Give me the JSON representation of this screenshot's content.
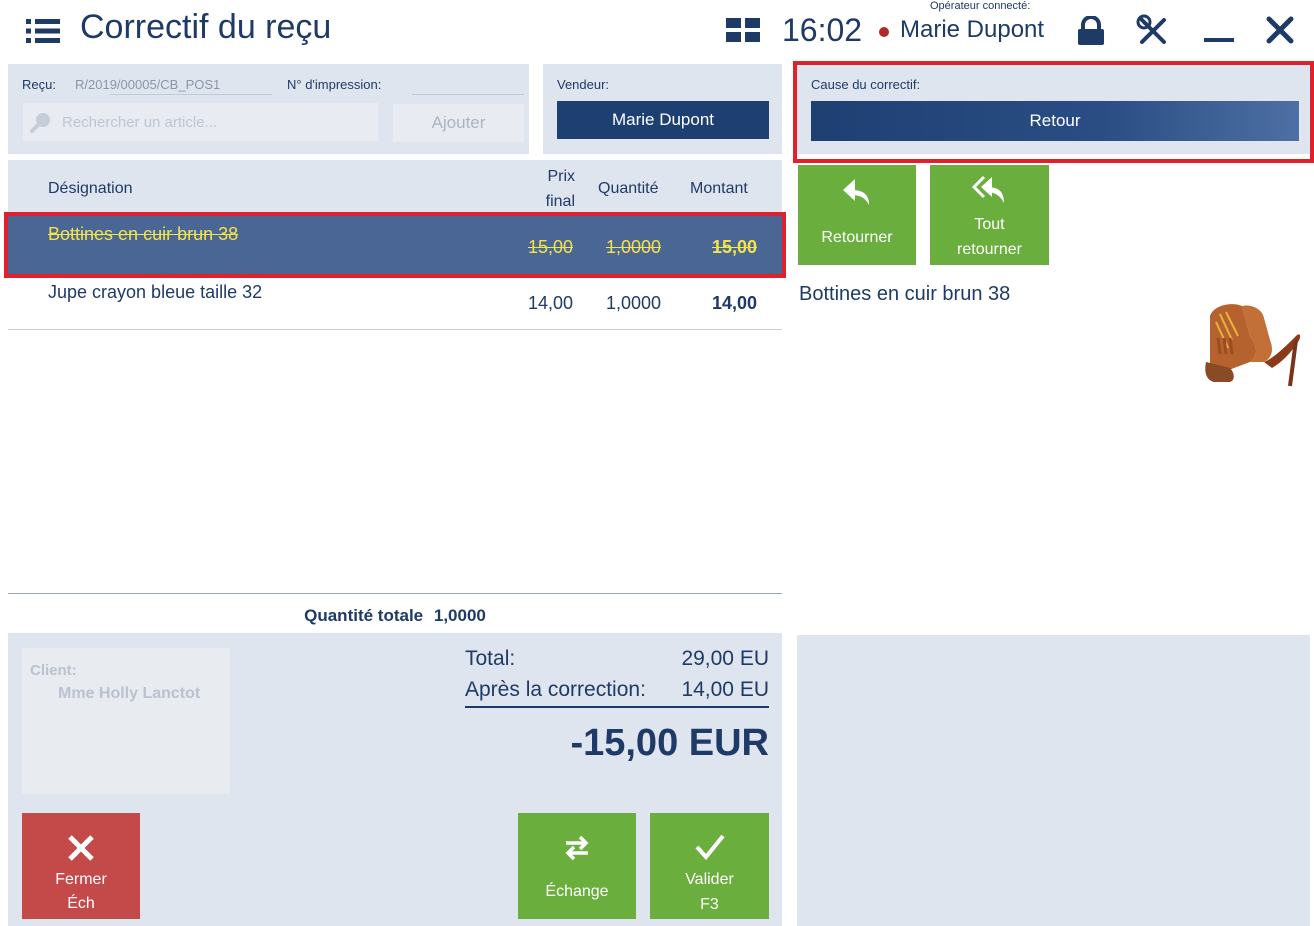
{
  "header": {
    "title": "Correctif du reçu",
    "time": "16:02",
    "operator_label": "Opérateur connecté:",
    "operator_name": "Marie Dupont"
  },
  "receipt": {
    "receipt_label": "Reçu:",
    "receipt_value": "R/2019/00005/CB_POS1",
    "print_label": "N° d'impression:",
    "print_value": "",
    "search_placeholder": "Rechercher un article...",
    "add_label": "Ajouter"
  },
  "seller": {
    "label": "Vendeur:",
    "value": "Marie Dupont"
  },
  "table": {
    "columns": {
      "designation": "Désignation",
      "price_line1": "Prix",
      "price_line2": "final",
      "quantity": "Quantité",
      "amount": "Montant"
    },
    "rows": [
      {
        "designation": "Bottines en cuir brun 38",
        "price": "15,00",
        "quantity": "1,0000",
        "amount": "15,00"
      },
      {
        "designation": "Jupe crayon bleue taille 32",
        "price": "14,00",
        "quantity": "1,0000",
        "amount": "14,00"
      }
    ],
    "total_qty_label": "Quantité totale",
    "total_qty_value": "1,0000"
  },
  "client": {
    "label": "Client:",
    "name": "Mme Holly Lanctot"
  },
  "totals": {
    "total_label": "Total:",
    "total_value": "29,00 EU",
    "after_label": "Après la correction:",
    "after_value": "14,00 EU",
    "difference": "-15,00 EUR"
  },
  "buttons": {
    "close_line1": "Fermer",
    "close_line2": "Éch",
    "exchange": "Échange",
    "validate_line1": "Valider",
    "validate_line2": "F3",
    "return": "Retourner",
    "return_all_line1": "Tout",
    "return_all_line2": "retourner"
  },
  "cause": {
    "label": "Cause du correctif:",
    "value": "Retour"
  },
  "selected_item": {
    "name": "Bottines en cuir brun 38"
  },
  "colors": {
    "primary": "#1e3f72",
    "selected_row": "#4a6694",
    "highlight_border": "#e0202a",
    "green": "#6aaf3e",
    "red": "#c44a4a",
    "strike_text": "#f5e34a"
  }
}
